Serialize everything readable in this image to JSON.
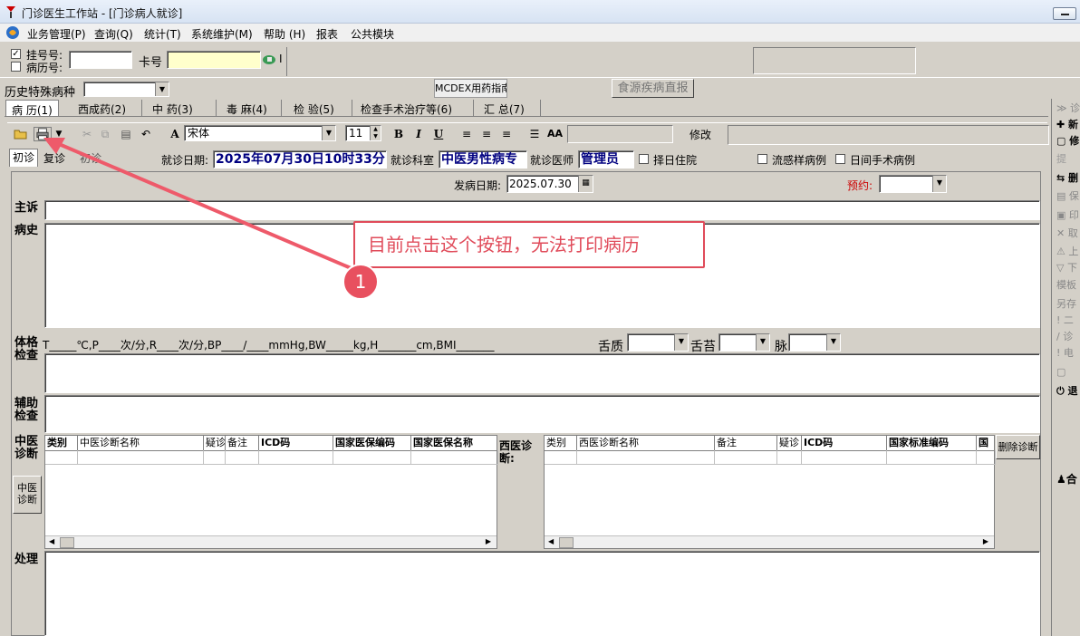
{
  "window": {
    "title": "门诊医生工作站 - [门诊病人就诊]"
  },
  "menu": [
    {
      "label": "业务管理(P)"
    },
    {
      "label": "查询(Q)"
    },
    {
      "label": "统计(T)"
    },
    {
      "label": "系统维护(M)"
    },
    {
      "label": "帮助 (H)"
    },
    {
      "label": "报表"
    },
    {
      "label": "公共模块"
    }
  ],
  "patient": {
    "reg_no_label": "挂号号:",
    "record_no_label": "病历号:",
    "card_label": "卡号",
    "reg_checked": true,
    "record_checked": false,
    "tail": "I"
  },
  "history": {
    "label": "历史特殊病种",
    "mcdex_button": "MCDEX用药指南",
    "food_button": "食源疾病直报"
  },
  "tabs": [
    {
      "label": "病 历(1)"
    },
    {
      "label": "西成药(2)"
    },
    {
      "label": "中 药(3)"
    },
    {
      "label": "毒 麻(4)"
    },
    {
      "label": "检 验(5)"
    },
    {
      "label": "检查手术治疗等(6)"
    },
    {
      "label": "汇 总(7)"
    }
  ],
  "toolbar": {
    "font_name": "宋体",
    "font_size": "11",
    "bold": "B",
    "italic": "I",
    "underline": "U",
    "modify": "修改"
  },
  "visit": {
    "first_visit": "初诊",
    "revisit": "复诊",
    "third": "初诊",
    "date_label": "就诊日期:",
    "date_value": "2025年07月30日10时33分",
    "dept_label": "就诊科室",
    "dept_value": "中医男性病专",
    "doctor_label": "就诊医师",
    "doctor_value": "管理员",
    "hospitalize": "择日住院",
    "flu": "流感样病例",
    "daysurgery": "日间手术病例"
  },
  "onset": {
    "label": "发病日期:",
    "value": "2025.07.30",
    "appointment": "预约:"
  },
  "sections": {
    "complaint": "主诉",
    "history": "病史",
    "physical": "体格检查",
    "aux": "辅助检查",
    "tcm_diag": "中医诊断",
    "west_diag": "西医诊断:",
    "treatment": "处理",
    "tcm_side_button": "中医诊断"
  },
  "vitals": {
    "text": "T_____℃,P____次/分,R____次/分,BP____/____mmHg,BW_____kg,H_______cm,BMI_______",
    "tongue": "舌质",
    "coating": "舌苔",
    "pulse": "脉"
  },
  "tcm_grid": {
    "columns": [
      "类别",
      "中医诊断名称",
      "疑诊",
      "备注",
      "ICD码",
      "国家医保编码",
      "国家医保名称"
    ]
  },
  "west_grid": {
    "columns": [
      "类别",
      "西医诊断名称",
      "备注",
      "疑诊",
      "ICD码",
      "国家标准编码",
      "国"
    ]
  },
  "delete_diag_button": "删除诊断",
  "right_toolbar": [
    {
      "label": "≫ 诊"
    },
    {
      "label": "✚ 新"
    },
    {
      "label": "▢ 修"
    },
    {
      "label": "  提"
    },
    {
      "label": "⇆ 删"
    },
    {
      "label": "▤ 保"
    },
    {
      "label": "▣ 印"
    },
    {
      "label": "✕ 取"
    },
    {
      "label": "⚠ 上"
    },
    {
      "label": "▽ 下"
    },
    {
      "label": "模板"
    },
    {
      "label": "另存"
    },
    {
      "label": "! 二"
    },
    {
      "label": "/ 诊"
    },
    {
      "label": "! 电"
    },
    {
      "label": "▢ "
    },
    {
      "label": "⏻ 退"
    }
  ],
  "right_extra": "合",
  "callout": {
    "text": "目前点击这个按钮，无法打印病历",
    "badge": "1"
  }
}
